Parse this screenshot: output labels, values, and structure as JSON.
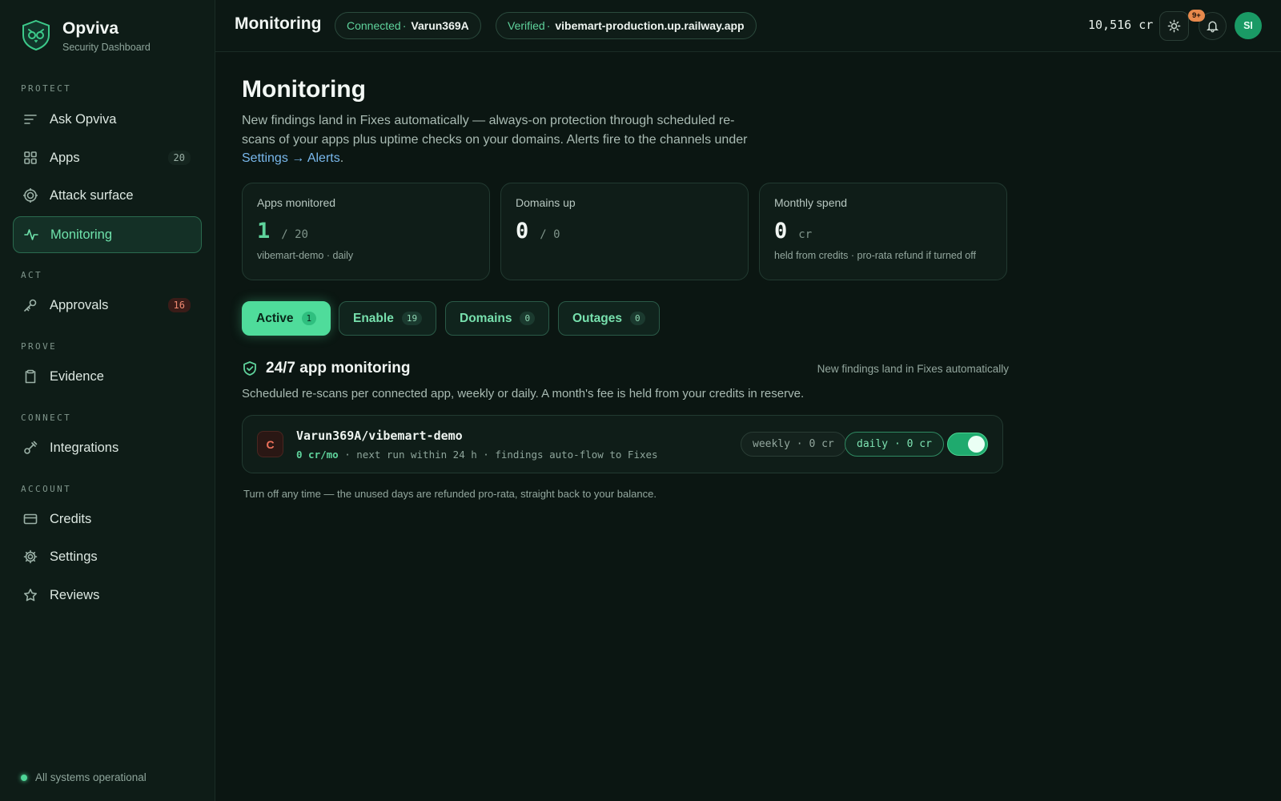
{
  "brand": {
    "name": "Opviva",
    "subtitle": "Security Dashboard"
  },
  "sidebar": {
    "sections": [
      "PROTECT",
      "ACT",
      "PROVE",
      "CONNECT",
      "ACCOUNT"
    ],
    "items": [
      {
        "label": "Ask Opviva",
        "icon": "list-icon"
      },
      {
        "label": "Apps",
        "icon": "grid-icon",
        "count": "20"
      },
      {
        "label": "Attack surface",
        "icon": "target-icon"
      },
      {
        "label": "Monitoring",
        "icon": "pulse-icon",
        "active": true
      },
      {
        "label": "Approvals",
        "icon": "key-icon",
        "count": "16"
      },
      {
        "label": "Evidence",
        "icon": "clipboard-icon"
      },
      {
        "label": "Integrations",
        "icon": "plug-icon"
      },
      {
        "label": "Credits",
        "icon": "card-icon"
      },
      {
        "label": "Settings",
        "icon": "gear-icon"
      },
      {
        "label": "Reviews",
        "icon": "star-icon"
      }
    ],
    "status": "All systems operational"
  },
  "topbar": {
    "title": "Monitoring",
    "connected_label": "Connected",
    "connected_value": "Varun369A",
    "verified_label": "Verified",
    "verified_value": "vibemart-production.up.railway.app",
    "credits": "10,516 cr",
    "notif_badge": "9+",
    "avatar": "SI"
  },
  "page": {
    "title": "Monitoring",
    "desc_pre": "New findings land in Fixes automatically — always-on protection through scheduled re-scans of your apps plus uptime checks on your domains. Alerts fire to the channels under ",
    "desc_link": "Settings → Alerts",
    "desc_post": "."
  },
  "stats": [
    {
      "label": "Apps monitored",
      "value": "1",
      "suffix": "/ 20",
      "foot": "vibemart-demo · daily",
      "value_color": "#5fd39c"
    },
    {
      "label": "Domains up",
      "value": "0",
      "suffix": "/ 0",
      "foot": "",
      "value_color": "#f1f6f3"
    },
    {
      "label": "Monthly spend",
      "value": "0",
      "suffix": "cr",
      "foot": "held from credits · pro-rata refund if turned off",
      "value_color": "#f1f6f3"
    }
  ],
  "tabs": [
    {
      "label": "Active",
      "count": "1"
    },
    {
      "label": "Enable",
      "count": "19"
    },
    {
      "label": "Domains",
      "count": "0"
    },
    {
      "label": "Outages",
      "count": "0"
    }
  ],
  "section": {
    "title": "24/7 app monitoring",
    "right_note": "New findings land in Fixes automatically",
    "desc": "Scheduled re-scans per connected app, weekly or daily. A month's fee is held from your credits in reserve."
  },
  "app": {
    "initial": "C",
    "name": "Varun369A/vibemart-demo",
    "price": "0 cr/mo",
    "meta": " · next run within 24 h · findings auto-flow to Fixes",
    "weekly": "weekly · 0 cr",
    "daily": "daily · 0 cr",
    "enabled": true
  },
  "footnote": "Turn off any time — the unused days are refunded pro-rata, straight back to your balance."
}
